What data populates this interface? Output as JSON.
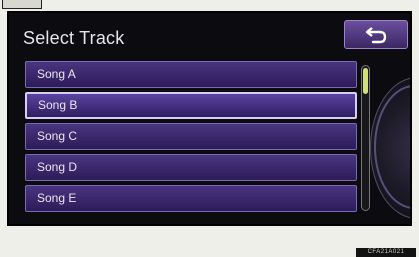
{
  "header": {
    "title": "Select Track"
  },
  "back_button": {
    "icon": "return-arrow-icon"
  },
  "tracks": [
    {
      "label": "Song A",
      "selected": false
    },
    {
      "label": "Song B",
      "selected": true
    },
    {
      "label": "Song C",
      "selected": false
    },
    {
      "label": "Song D",
      "selected": false
    },
    {
      "label": "Song E",
      "selected": false
    }
  ],
  "scroll": {
    "position": 0
  },
  "colors": {
    "accent": "#5a44a0",
    "selection_border": "#d8cdf3",
    "scroll_thumb": "#d2e07a"
  },
  "reference_code": "CFA21A021"
}
